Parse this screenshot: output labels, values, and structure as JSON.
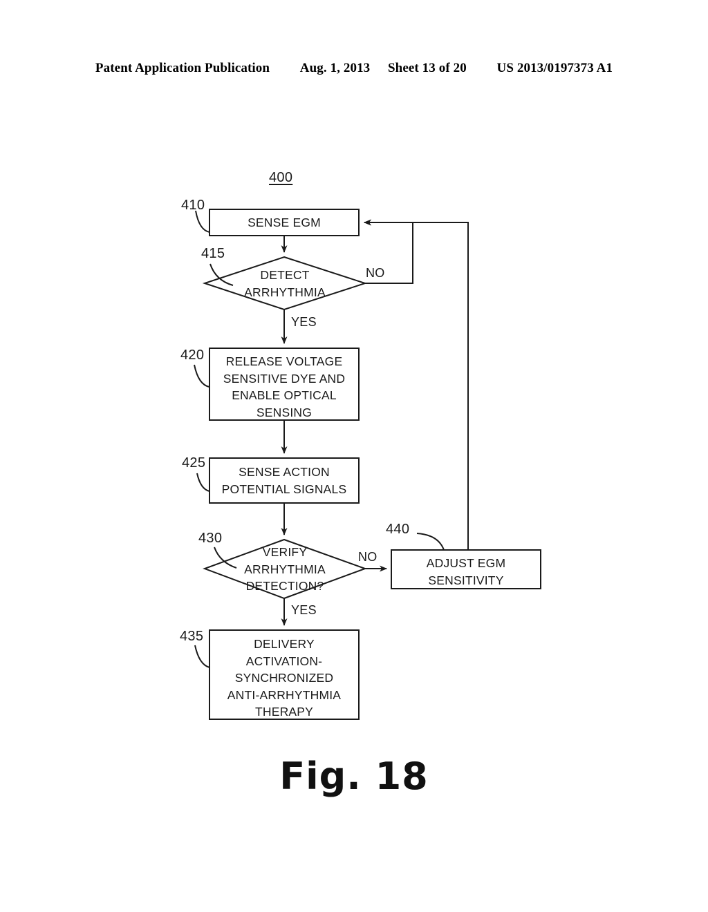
{
  "header": {
    "publication": "Patent Application Publication",
    "date": "Aug. 1, 2013",
    "sheet": "Sheet 13 of 20",
    "patent_number": "US 2013/0197373 A1"
  },
  "figure": {
    "caption": "Fig. 18",
    "diagram_number": "400"
  },
  "flowchart": {
    "nodes": [
      {
        "ref": "410",
        "shape": "process",
        "text": "SENSE EGM"
      },
      {
        "ref": "415",
        "shape": "decision",
        "text": "DETECT\nARRHYTHMIA"
      },
      {
        "ref": "420",
        "shape": "process",
        "text": "RELEASE VOLTAGE\nSENSITIVE DYE AND\nENABLE OPTICAL\nSENSING"
      },
      {
        "ref": "425",
        "shape": "process",
        "text": "SENSE ACTION\nPOTENTIAL SIGNALS"
      },
      {
        "ref": "430",
        "shape": "decision",
        "text": "VERIFY\nARRHYTHMIA\nDETECTION?"
      },
      {
        "ref": "435",
        "shape": "process",
        "text": "DELIVERY\nACTIVATION-\nSYNCHRONIZED\nANTI-ARRHYTHMIA\nTHERAPY"
      },
      {
        "ref": "440",
        "shape": "process",
        "text": "ADJUST EGM\nSENSITIVITY"
      }
    ],
    "branch_labels": {
      "detect_no": "NO",
      "detect_yes": "YES",
      "verify_no": "NO",
      "verify_yes": "YES"
    }
  },
  "colors": {
    "line": "#1a1a1a",
    "text": "#1a1a1a",
    "background": "#ffffff"
  }
}
